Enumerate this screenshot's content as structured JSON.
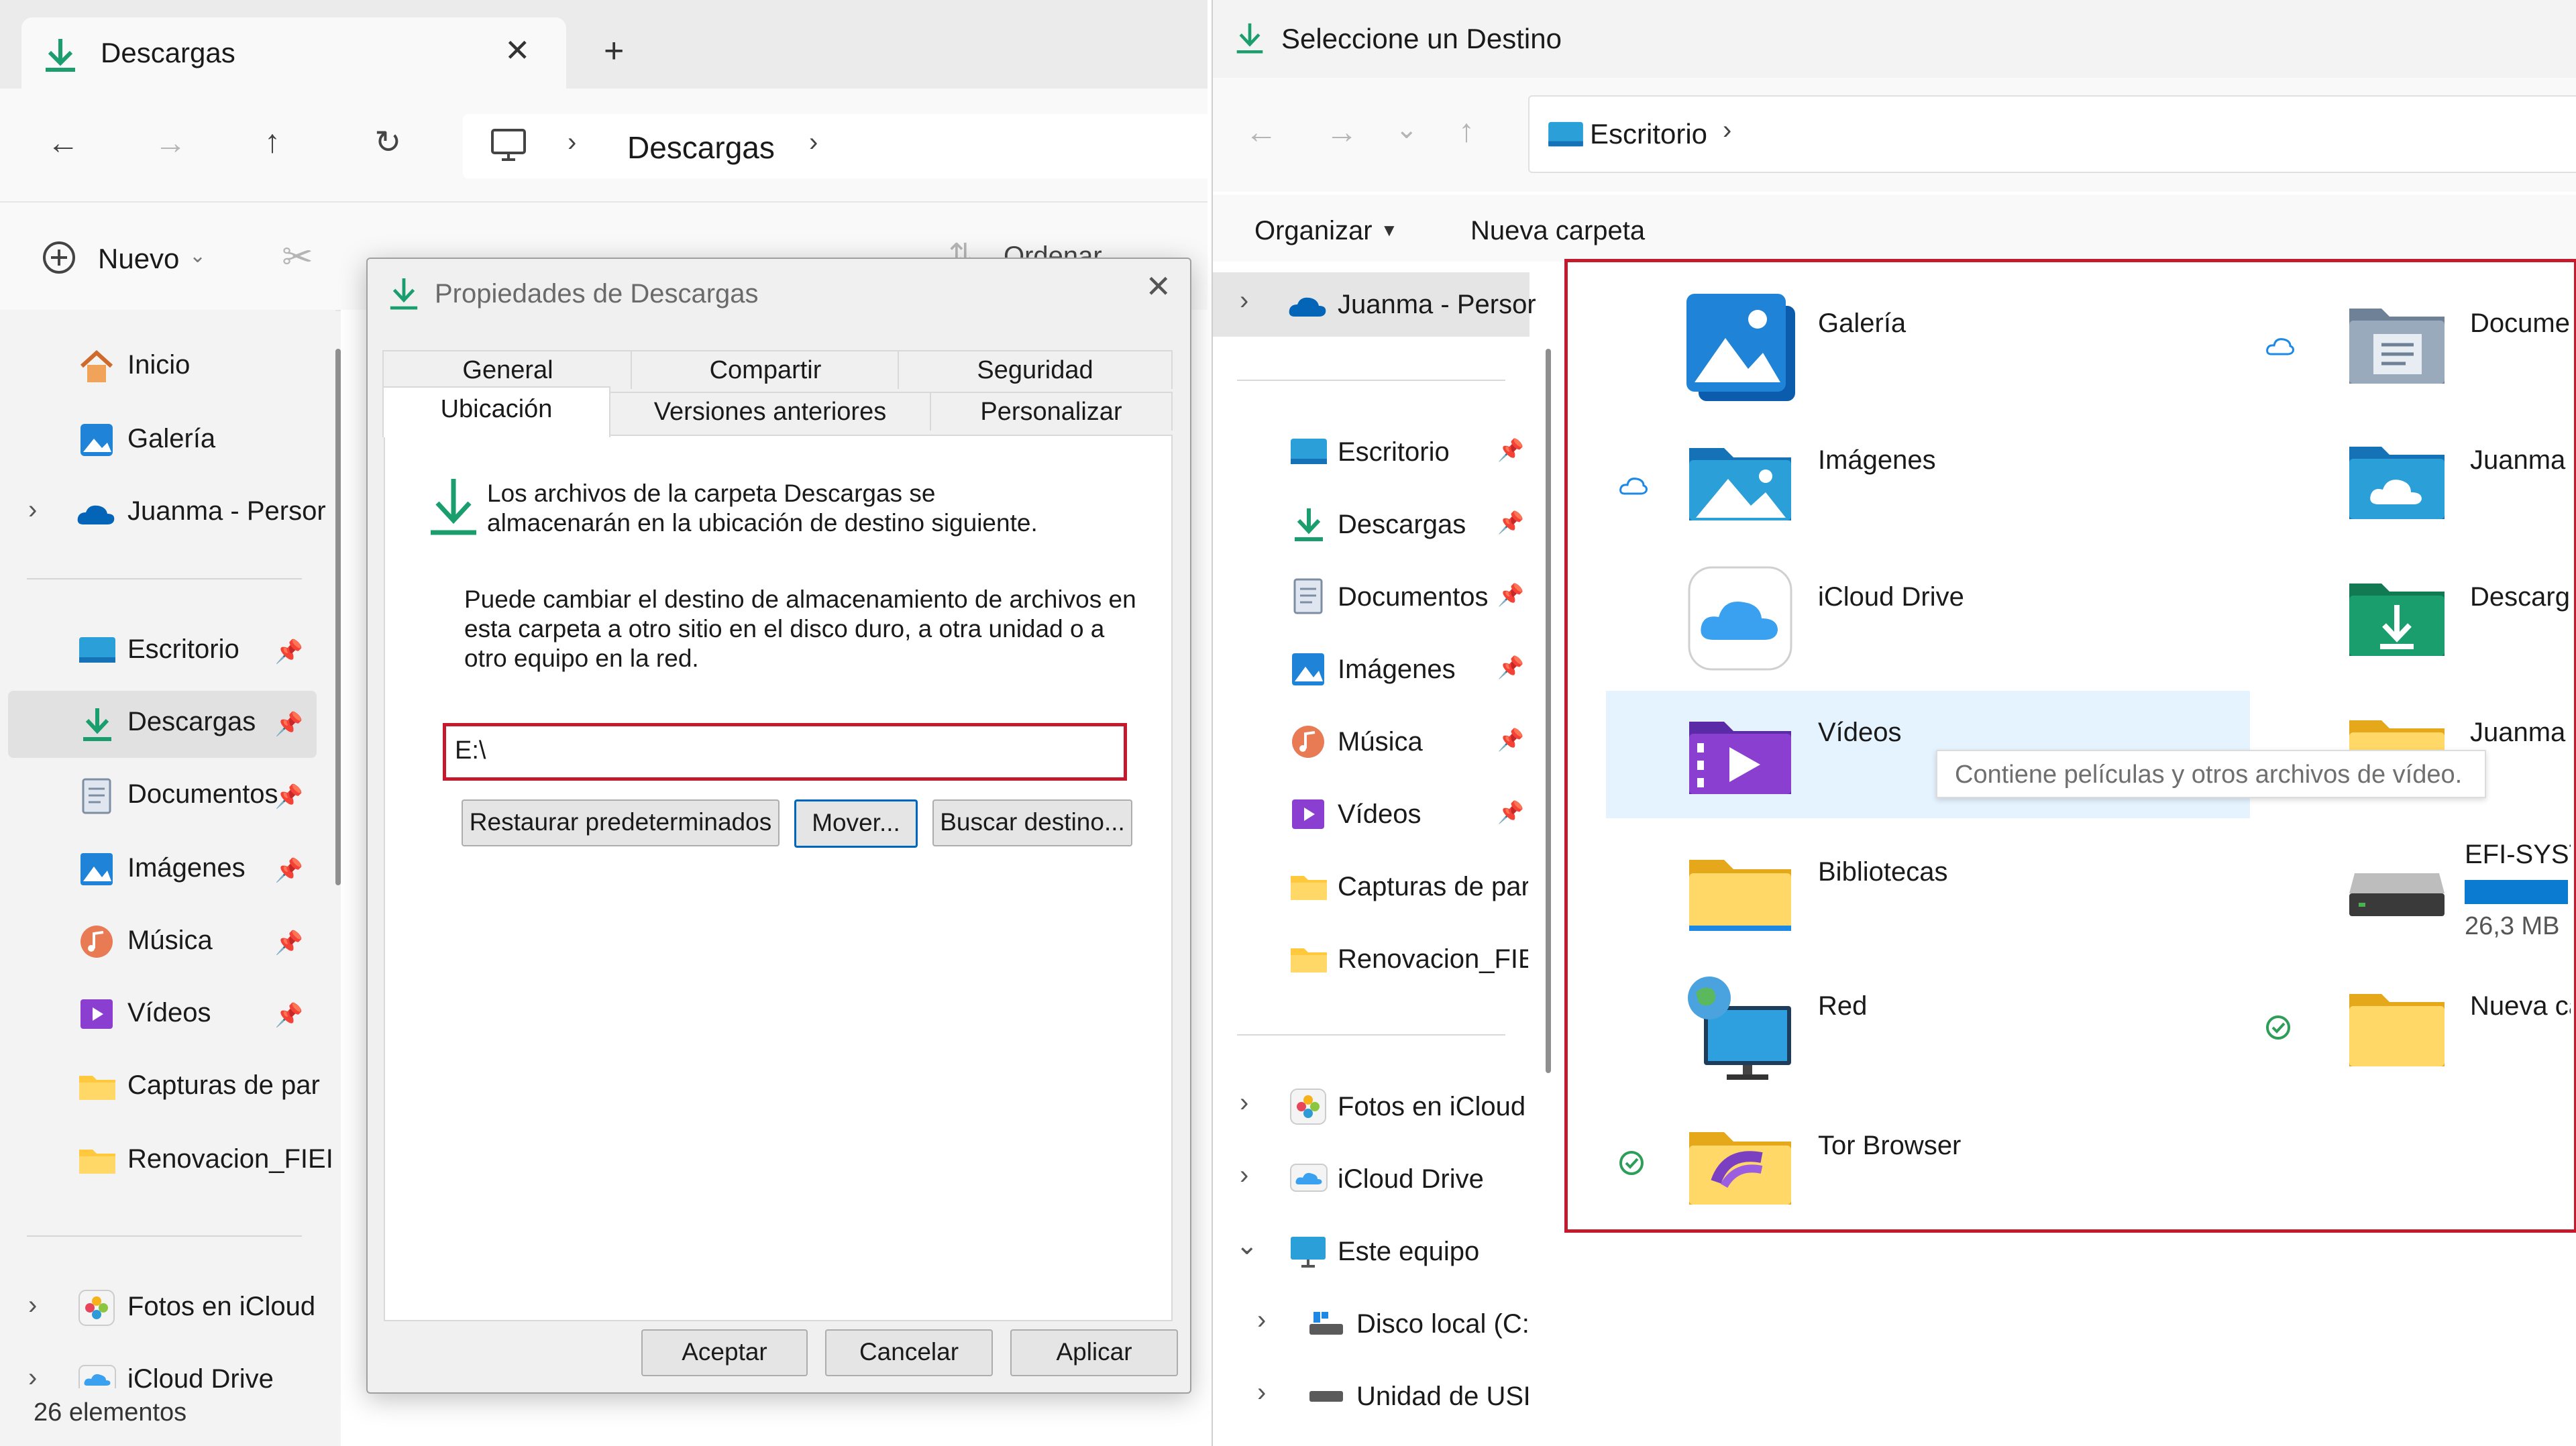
{
  "colors": {
    "accent": "#0067c0",
    "highlight_red": "#c5192d",
    "selected_bg": "#e1e1e1",
    "hover_bg": "#e5f3ff",
    "folder_yellow": "#ffd24d",
    "download_green": "#1a9e6e"
  },
  "left_explorer": {
    "tab_title": "Descargas",
    "breadcrumb": [
      "Descargas"
    ],
    "nuevo_label": "Nuevo",
    "ordenar_label": "Ordenar",
    "sidebar": [
      {
        "label": "Inicio",
        "icon": "home-icon"
      },
      {
        "label": "Galería",
        "icon": "gallery-icon"
      },
      {
        "label": "Juanma - Persor",
        "icon": "onedrive-icon"
      },
      {
        "label": "Escritorio",
        "icon": "desktop-icon"
      },
      {
        "label": "Descargas",
        "icon": "download-icon",
        "selected": true
      },
      {
        "label": "Documentos",
        "icon": "documents-icon"
      },
      {
        "label": "Imágenes",
        "icon": "pictures-icon"
      },
      {
        "label": "Música",
        "icon": "music-icon"
      },
      {
        "label": "Vídeos",
        "icon": "videos-icon"
      },
      {
        "label": "Capturas de par",
        "icon": "folder-icon"
      },
      {
        "label": "Renovacion_FIEI",
        "icon": "folder-icon"
      },
      {
        "label": "Fotos en iCloud",
        "icon": "icloud-photos-icon"
      },
      {
        "label": "iCloud Drive",
        "icon": "icloud-drive-icon"
      }
    ],
    "status": "26 elementos"
  },
  "dialog": {
    "title": "Propiedades de Descargas",
    "tabs_row1": [
      "General",
      "Compartir",
      "Seguridad"
    ],
    "tabs_row2": [
      "Ubicación",
      "Versiones anteriores",
      "Personalizar"
    ],
    "selected_tab": "Ubicación",
    "info_line1": "Los archivos de la carpeta Descargas se",
    "info_line2": "almacenarán en la ubicación de destino siguiente.",
    "desc_line1": "Puede cambiar el destino de almacenamiento de archivos en",
    "desc_line2": "esta carpeta a otro sitio en el disco duro, a otra unidad o a",
    "desc_line3": "otro equipo en la red.",
    "path_value": "E:\\",
    "btn_restore": "Restaurar predeterminados",
    "btn_move": "Mover...",
    "btn_find": "Buscar destino...",
    "btn_ok": "Aceptar",
    "btn_cancel": "Cancelar",
    "btn_apply": "Aplicar"
  },
  "right_dialog": {
    "title": "Seleccione un Destino",
    "address": "Escritorio",
    "organizar": "Organizar",
    "nueva_carpeta": "Nueva carpeta",
    "sidebar": [
      {
        "label": "Juanma - Persor",
        "icon": "onedrive-icon"
      },
      {
        "label": "Escritorio",
        "icon": "desktop-icon"
      },
      {
        "label": "Descargas",
        "icon": "download-icon"
      },
      {
        "label": "Documentos",
        "icon": "documents-icon"
      },
      {
        "label": "Imágenes",
        "icon": "pictures-icon"
      },
      {
        "label": "Música",
        "icon": "music-icon"
      },
      {
        "label": "Vídeos",
        "icon": "videos-icon"
      },
      {
        "label": "Capturas de par",
        "icon": "folder-icon"
      },
      {
        "label": "Renovacion_FIEI",
        "icon": "folder-icon"
      },
      {
        "label": "Fotos en iCloud",
        "icon": "icloud-photos-icon"
      },
      {
        "label": "iCloud Drive",
        "icon": "icloud-drive-icon"
      },
      {
        "label": "Este equipo",
        "icon": "computer-icon"
      },
      {
        "label": "Disco local (C:)",
        "icon": "drive-icon"
      },
      {
        "label": "Unidad de USB",
        "icon": "usb-drive-icon"
      }
    ],
    "tiles_left": [
      {
        "label": "Galería",
        "icon": "gallery-icon"
      },
      {
        "label": "Imágenes",
        "icon": "pictures-icon"
      },
      {
        "label": "iCloud Drive",
        "icon": "icloud-drive-icon"
      },
      {
        "label": "Vídeos",
        "icon": "videos-icon"
      },
      {
        "label": "Bibliotecas",
        "icon": "libraries-icon"
      },
      {
        "label": "Red",
        "icon": "network-icon"
      },
      {
        "label": "Tor Browser",
        "icon": "tor-folder-icon"
      }
    ],
    "tiles_right": [
      {
        "label": "Docume",
        "icon": "documents-folder-icon"
      },
      {
        "label": "Juanma",
        "icon": "onedrive-folder-icon"
      },
      {
        "label": "Descarga",
        "icon": "downloads-folder-icon"
      },
      {
        "label": "Juanma",
        "icon": "folder-icon"
      },
      {
        "label": "EFI-SYST",
        "icon": "drive-icon",
        "size": "26,3 MB",
        "used_fraction": 1.0
      },
      {
        "label": "Nueva ca",
        "icon": "folder-icon"
      }
    ],
    "tooltip": "Contiene películas y otros archivos de vídeo."
  }
}
